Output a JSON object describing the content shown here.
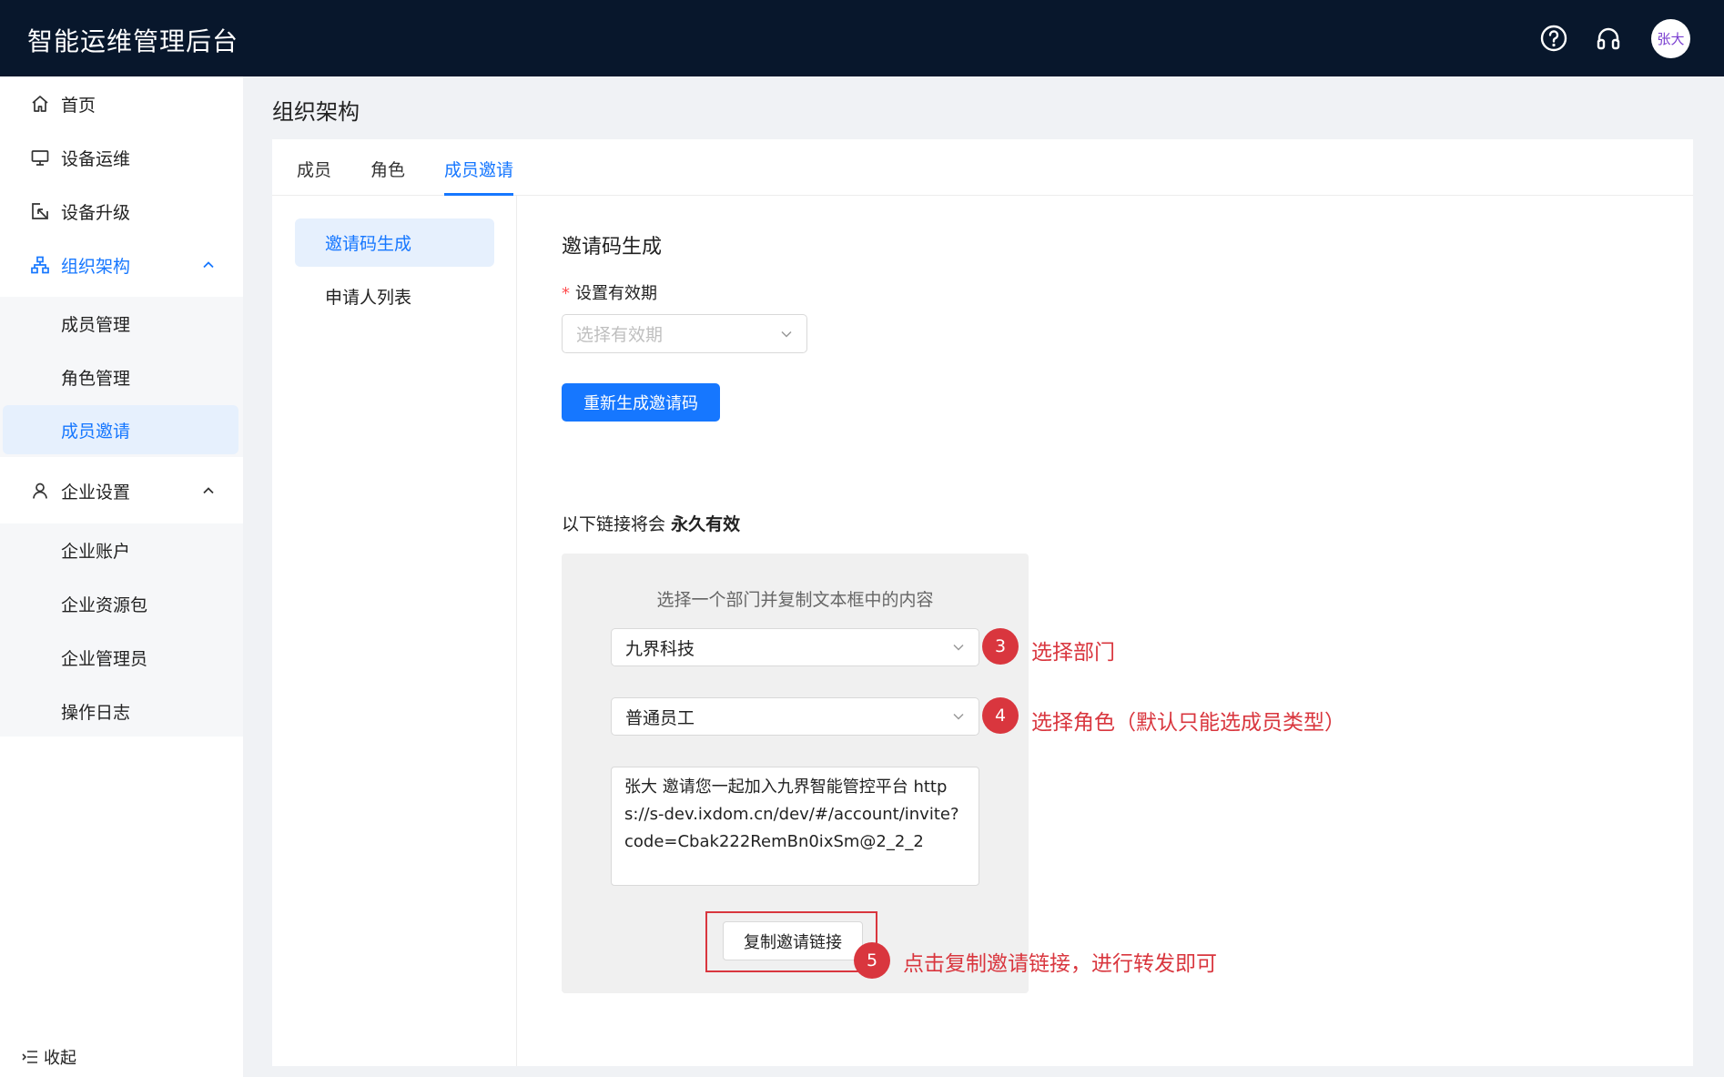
{
  "header": {
    "title": "智能运维管理后台",
    "help_icon": "help-circle-icon",
    "support_icon": "headset-icon",
    "avatar_text": "张大"
  },
  "sidebar": {
    "items": [
      {
        "label": "首页",
        "icon": "home-icon"
      },
      {
        "label": "设备运维",
        "icon": "monitor-icon"
      },
      {
        "label": "设备升级",
        "icon": "upgrade-icon"
      },
      {
        "label": "组织架构",
        "icon": "org-tree-icon",
        "expanded": true,
        "children": [
          "成员管理",
          "角色管理",
          "成员邀请"
        ],
        "active_child": "成员邀请"
      },
      {
        "label": "企业设置",
        "icon": "user-icon",
        "expanded": true,
        "children": [
          "企业账户",
          "企业资源包",
          "企业管理员",
          "操作日志"
        ]
      }
    ],
    "collapse_label": "收起"
  },
  "page": {
    "title": "组织架构",
    "tabs": [
      "成员",
      "角色",
      "成员邀请"
    ],
    "active_tab": "成员邀请",
    "subnav": [
      "邀请码生成",
      "申请人列表"
    ],
    "active_subnav": "邀请码生成"
  },
  "invite": {
    "section_title": "邀请码生成",
    "validity_label": "设置有效期",
    "validity_placeholder": "选择有效期",
    "regenerate_label": "重新生成邀请码",
    "note_prefix": "以下链接将会",
    "note_bold": "永久有效",
    "panel_caption": "选择一个部门并复制文本框中的内容",
    "department_value": "九界科技",
    "role_value": "普通员工",
    "invite_text": "张大 邀请您一起加入九界智能管控平台 https://s-dev.ixdom.cn/dev/#/account/invite?code=Cbak222RemBn0ixSm@2_2_2",
    "copy_label": "复制邀请链接"
  },
  "annotations": {
    "step3": {
      "num": "3",
      "text": "选择部门"
    },
    "step4": {
      "num": "4",
      "text": "选择角色（默认只能选成员类型）"
    },
    "step5": {
      "num": "5",
      "text": "点击复制邀请链接，进行转发即可"
    },
    "color": "#d9363e"
  },
  "colors": {
    "header_bg": "#08172c",
    "primary": "#1677ff",
    "active_bg": "#e6f0fd"
  }
}
